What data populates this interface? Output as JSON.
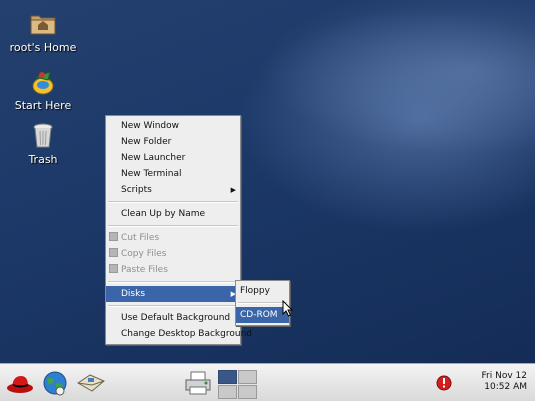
{
  "desktop_icons": [
    {
      "label": "root's Home",
      "icon": "home-folder-icon"
    },
    {
      "label": "Start Here",
      "icon": "start-here-icon"
    },
    {
      "label": "Trash",
      "icon": "trash-icon"
    }
  ],
  "context_menu": {
    "new_window": "New Window",
    "new_folder": "New Folder",
    "new_launcher": "New Launcher",
    "new_terminal": "New Terminal",
    "scripts": "Scripts",
    "clean_up": "Clean Up by Name",
    "cut_files": "Cut Files",
    "copy_files": "Copy Files",
    "paste_files": "Paste Files",
    "disks": "Disks",
    "use_default_bg": "Use Default Background",
    "change_bg": "Change Desktop Background"
  },
  "disks_submenu": {
    "floppy": "Floppy",
    "cdrom": "CD-ROM"
  },
  "panel": {
    "launchers": [
      "redhat-main-menu-icon",
      "web-browser-icon",
      "email-icon",
      "printer-icon"
    ],
    "clock": {
      "date": "Fri Nov 12",
      "time": "10:52 AM"
    },
    "notification_icon": "alert-notification-icon"
  },
  "colors": {
    "menu_highlight": "#3a65a9",
    "desktop_bg": "#1d3a6a"
  }
}
